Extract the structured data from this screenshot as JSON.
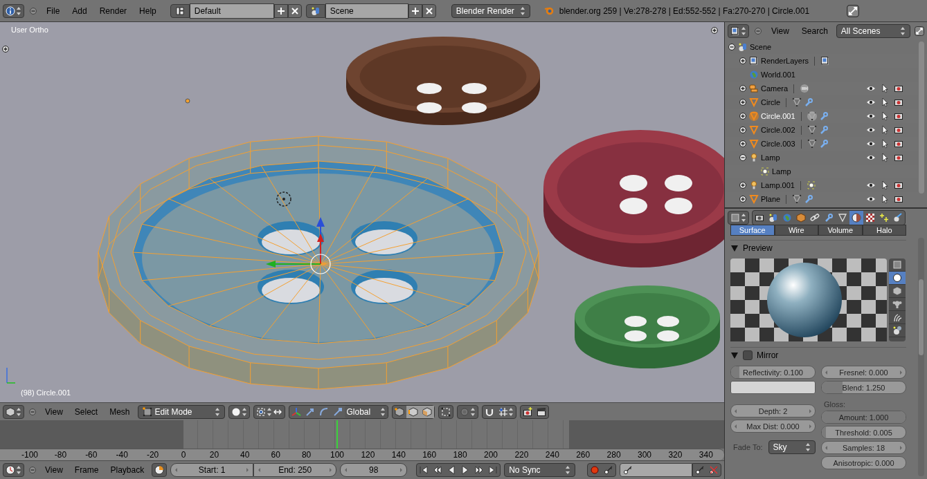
{
  "top_bar": {
    "menus": [
      "File",
      "Add",
      "Render",
      "Help"
    ],
    "layout": "Default",
    "scene": "Scene",
    "engine": "Blender Render",
    "stats": "blender.org 259 | Ve:278-278 | Ed:552-552 | Fa:270-270 | Circle.001"
  },
  "viewport": {
    "view_name": "User Ortho",
    "object_label": "(98) Circle.001"
  },
  "viewport_header": {
    "menus": [
      "View",
      "Select",
      "Mesh"
    ],
    "mode": "Edit Mode",
    "orientation": "Global",
    "select_modes": [
      {
        "kind": "vertex",
        "selected": false
      },
      {
        "kind": "edge",
        "selected": true
      },
      {
        "kind": "face",
        "selected": true
      }
    ]
  },
  "timeline": {
    "ticks": [
      "-100",
      "-80",
      "-60",
      "-40",
      "-20",
      "0",
      "20",
      "40",
      "60",
      "80",
      "100",
      "120",
      "140",
      "160",
      "180",
      "200",
      "220",
      "240",
      "260",
      "280",
      "300",
      "320",
      "340"
    ]
  },
  "timeline_header": {
    "menus": [
      "View",
      "Frame",
      "Playback"
    ],
    "start": "Start: 1",
    "end": "End: 250",
    "frame": "98",
    "sync": "No Sync"
  },
  "outliner": {
    "menus": [
      "View",
      "Search"
    ],
    "filter": "All Scenes",
    "tree": [
      {
        "label": "Scene",
        "kind": "scene",
        "expanded": true,
        "selected": false,
        "children": [
          {
            "label": "RenderLayers",
            "kind": "renderlayers",
            "expanded": false,
            "selected": false
          },
          {
            "label": "World.001",
            "kind": "world",
            "selected": false
          },
          {
            "label": "Camera",
            "kind": "camera",
            "expanded": false,
            "selected": false
          },
          {
            "label": "Circle",
            "kind": "mesh",
            "expanded": false,
            "selected": false
          },
          {
            "label": "Circle.001",
            "kind": "mesh",
            "expanded": false,
            "selected": true
          },
          {
            "label": "Circle.002",
            "kind": "mesh",
            "expanded": false,
            "selected": false
          },
          {
            "label": "Circle.003",
            "kind": "mesh",
            "expanded": false,
            "selected": false
          },
          {
            "label": "Lamp",
            "kind": "lamp",
            "expanded": true,
            "selected": false,
            "children": [
              {
                "label": "Lamp",
                "kind": "lampdata",
                "selected": false
              }
            ]
          },
          {
            "label": "Lamp.001",
            "kind": "lamp",
            "expanded": false,
            "selected": false
          },
          {
            "label": "Plane",
            "kind": "mesh",
            "expanded": false,
            "selected": false
          }
        ]
      }
    ]
  },
  "properties": {
    "context_tabs": [
      {
        "kind": "render",
        "selected": false
      },
      {
        "kind": "scene",
        "selected": false
      },
      {
        "kind": "world",
        "selected": false
      },
      {
        "kind": "object",
        "selected": false
      },
      {
        "kind": "constraints",
        "selected": false
      },
      {
        "kind": "modifiers",
        "selected": false
      },
      {
        "kind": "data",
        "selected": false
      },
      {
        "kind": "material",
        "selected": true
      },
      {
        "kind": "texture",
        "selected": false
      },
      {
        "kind": "particles",
        "selected": false
      },
      {
        "kind": "physics",
        "selected": false
      }
    ],
    "subtabs": [
      {
        "label": "Surface",
        "selected": true
      },
      {
        "label": "Wire",
        "selected": false
      },
      {
        "label": "Volume",
        "selected": false
      },
      {
        "label": "Halo",
        "selected": false
      }
    ],
    "preview": {
      "title": "Preview",
      "expanded": true,
      "shapes": [
        {
          "kind": "flat",
          "selected": false
        },
        {
          "kind": "sphere",
          "selected": true
        },
        {
          "kind": "cube",
          "selected": false
        },
        {
          "kind": "monkey",
          "selected": false
        },
        {
          "kind": "hair",
          "selected": false
        },
        {
          "kind": "sky",
          "selected": false
        }
      ]
    },
    "mirror": {
      "title": "Mirror",
      "expanded": true,
      "enabled": false,
      "left": [
        {
          "kind": "slider",
          "label": "Reflectivity: 0.100",
          "level": 0.1
        },
        {
          "kind": "color",
          "color": "#d4d4d4"
        },
        {
          "kind": "number",
          "label": "Depth: 2"
        },
        {
          "kind": "number",
          "label": "Max Dist: 0.000"
        },
        {
          "kind": "dropdown",
          "label": "Fade To:",
          "value": "Sky"
        }
      ],
      "right": [
        {
          "kind": "number",
          "label": "Fresnel: 0.000"
        },
        {
          "kind": "slider",
          "label": "Blend: 1.250",
          "level": 0.25
        },
        {
          "kind": "label",
          "label": "Gloss:"
        },
        {
          "kind": "slider",
          "label": "Amount: 1.000",
          "level": 1
        },
        {
          "kind": "slider",
          "label": "Threshold: 0.005",
          "level": 0.05
        },
        {
          "kind": "number",
          "label": "Samples: 18"
        },
        {
          "kind": "slider",
          "label": "Anisotropic: 0.000"
        }
      ]
    }
  }
}
